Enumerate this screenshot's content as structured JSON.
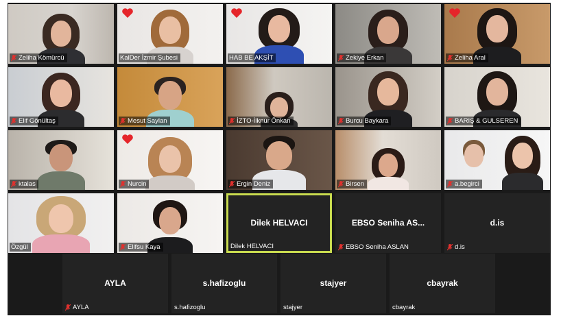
{
  "meeting": {
    "colors": {
      "stage_bg": "#1a1a1a",
      "active_speaker_border": "#c9dc4f",
      "muted_icon": "#e0312e",
      "heart": "#e5252a"
    },
    "participants": [
      {
        "name": "Zeliha Kömürcü",
        "muted": true,
        "heart": false,
        "video": true
      },
      {
        "name": "KalDer İzmir Şubesi",
        "muted": false,
        "heart": true,
        "video": true
      },
      {
        "name": "HAB BE AKŞİT",
        "muted": false,
        "heart": true,
        "video": true
      },
      {
        "name": "Zekiye Erkan",
        "muted": true,
        "heart": false,
        "video": true
      },
      {
        "name": "Zeliha Aral",
        "muted": true,
        "heart": true,
        "video": true
      },
      {
        "name": "Elif Gönültaş",
        "muted": true,
        "heart": false,
        "video": true
      },
      {
        "name": "Mesut Saylan",
        "muted": true,
        "heart": false,
        "video": true
      },
      {
        "name": "İZTO-İlknur Önkan",
        "muted": true,
        "heart": false,
        "video": true
      },
      {
        "name": "Burcu Baykara",
        "muted": true,
        "heart": false,
        "video": true
      },
      {
        "name": "BARIŞ & GULSEREN",
        "muted": true,
        "heart": false,
        "video": true
      },
      {
        "name": "ktalas",
        "muted": true,
        "heart": false,
        "video": true
      },
      {
        "name": "Nurcin",
        "muted": true,
        "heart": true,
        "video": true
      },
      {
        "name": "Ergin Deniz",
        "muted": true,
        "heart": false,
        "video": true
      },
      {
        "name": "Birsen",
        "muted": true,
        "heart": false,
        "video": true
      },
      {
        "name": "a.begirci",
        "muted": true,
        "heart": false,
        "video": true
      },
      {
        "name": "Özgül",
        "muted": false,
        "heart": false,
        "video": true
      },
      {
        "name": "Elifsu Kaya",
        "muted": true,
        "heart": false,
        "video": true
      },
      {
        "name": "Dilek HELVACI",
        "display": "Dilek HELVACI",
        "muted": false,
        "heart": false,
        "video": false,
        "active": true
      },
      {
        "name": "EBSO Seniha ASLAN",
        "display": "EBSO Seniha AS...",
        "muted": true,
        "heart": false,
        "video": false
      },
      {
        "name": "d.is",
        "display": "d.is",
        "muted": true,
        "heart": false,
        "video": false
      }
    ],
    "bottom_participants": [
      {
        "name": "AYLA",
        "display": "AYLA",
        "muted": true,
        "video": false
      },
      {
        "name": "s.hafizoglu",
        "display": "s.hafizoglu",
        "muted": false,
        "video": false
      },
      {
        "name": "stajyer",
        "display": "stajyer",
        "muted": false,
        "video": false
      },
      {
        "name": "cbayrak",
        "display": "cbayrak",
        "muted": false,
        "video": false
      }
    ]
  }
}
